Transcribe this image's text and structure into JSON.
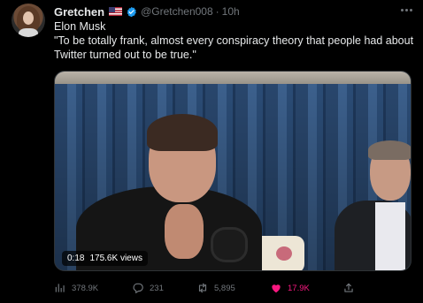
{
  "tweet": {
    "author": {
      "display_name": "Gretchen",
      "handle": "@Gretchen008",
      "flag_icon": "us-flag-icon",
      "verified_icon": "verified-badge-icon",
      "time": "10h"
    },
    "text_lines": [
      "Elon Musk",
      "\"To be totally frank, almost every conspiracy theory that people had about",
      "Twitter turned out to be true.\""
    ],
    "media": {
      "type": "video",
      "timestamp": "0:18",
      "views": "175.6K views"
    },
    "actions": {
      "views": "378.9K",
      "replies": "231",
      "retweets": "5,895",
      "likes": "17.9K",
      "like_active": true
    },
    "colors": {
      "background": "#000000",
      "text": "#e7e9ea",
      "muted": "#71767b",
      "verified": "#1d9bf0",
      "like": "#f91880"
    }
  }
}
